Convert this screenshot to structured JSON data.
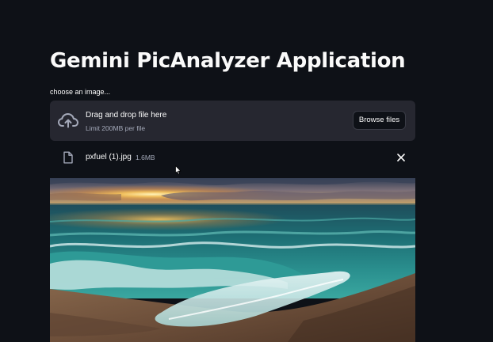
{
  "app": {
    "title": "Gemini PicAnalyzer Application"
  },
  "uploader": {
    "label": "choose an image...",
    "drop_text": "Drag and drop file here",
    "limit_text": "Limit 200MB per file",
    "browse_label": "Browse files",
    "icon": "cloud-upload-icon"
  },
  "uploaded_file": {
    "name": "pxfuel (1).jpg",
    "size": "1.6MB",
    "icon": "file-icon",
    "remove_icon": "close-icon"
  },
  "preview": {
    "subject": "beach sunset"
  },
  "colors": {
    "background": "#0e1117",
    "panel": "#262730",
    "text": "#fafafa",
    "muted": "#a3a8b8"
  }
}
